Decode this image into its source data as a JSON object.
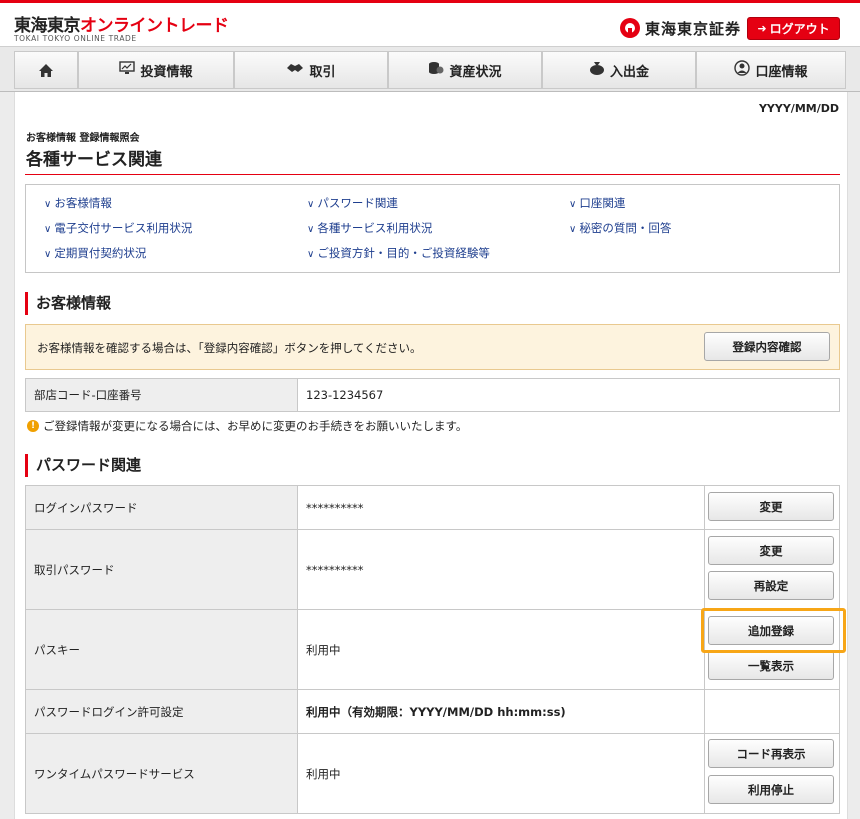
{
  "header": {
    "logo_part1": "東海東京",
    "logo_part2": "オンライントレード",
    "logo_sub": "TOKAI TOKYO ONLINE TRADE",
    "brand_name": "東海東京証券",
    "logout_label": "ログアウト"
  },
  "nav": {
    "items": [
      {
        "label": "",
        "icon": "home-icon"
      },
      {
        "label": "投資情報",
        "icon": "monitor-icon"
      },
      {
        "label": "取引",
        "icon": "handshake-icon"
      },
      {
        "label": "資産状況",
        "icon": "coins-icon"
      },
      {
        "label": "入出金",
        "icon": "money-bag-icon"
      },
      {
        "label": "口座情報",
        "icon": "user-icon"
      }
    ]
  },
  "page": {
    "date": "YYYY/MM/DD",
    "breadcrumb": "お客様情報 登録情報照会",
    "title": "各種サービス関連"
  },
  "links": [
    "お客様情報",
    "パスワード関連",
    "口座関連",
    "電子交付サービス利用状況",
    "各種サービス利用状況",
    "秘密の質問・回答",
    "定期買付契約状況",
    "ご投資方針・目的・ご投資経験等"
  ],
  "customer": {
    "section_title": "お客様情報",
    "notice_text": "お客様情報を確認する場合は、「登録内容確認」ボタンを押してください。",
    "confirm_button": "登録内容確認",
    "account_label": "部店コード-口座番号",
    "account_value": "123-1234567",
    "warning": "ご登録情報が変更になる場合には、お早めに変更のお手続きをお願いいたします。"
  },
  "password": {
    "section_title": "パスワード関連",
    "rows": [
      {
        "label": "ログインパスワード",
        "value": "**********",
        "buttons": [
          "変更"
        ]
      },
      {
        "label": "取引パスワード",
        "value": "**********",
        "buttons": [
          "変更",
          "再設定"
        ]
      },
      {
        "label": "パスキー",
        "value": "利用中",
        "buttons": [
          "追加登録",
          "一覧表示"
        ]
      },
      {
        "label": "パスワードログイン許可設定",
        "value": "利用中（有効期限：YYYY/MM/DD hh:mm:ss)",
        "buttons": []
      },
      {
        "label": "ワンタイムパスワードサービス",
        "value": "利用中",
        "buttons": [
          "コード再表示",
          "利用停止"
        ]
      }
    ]
  },
  "colors": {
    "brand_red": "#e50012",
    "link_blue": "#1f3f8f",
    "highlight_orange": "#f7a617",
    "notice_bg": "#fdf3de"
  }
}
